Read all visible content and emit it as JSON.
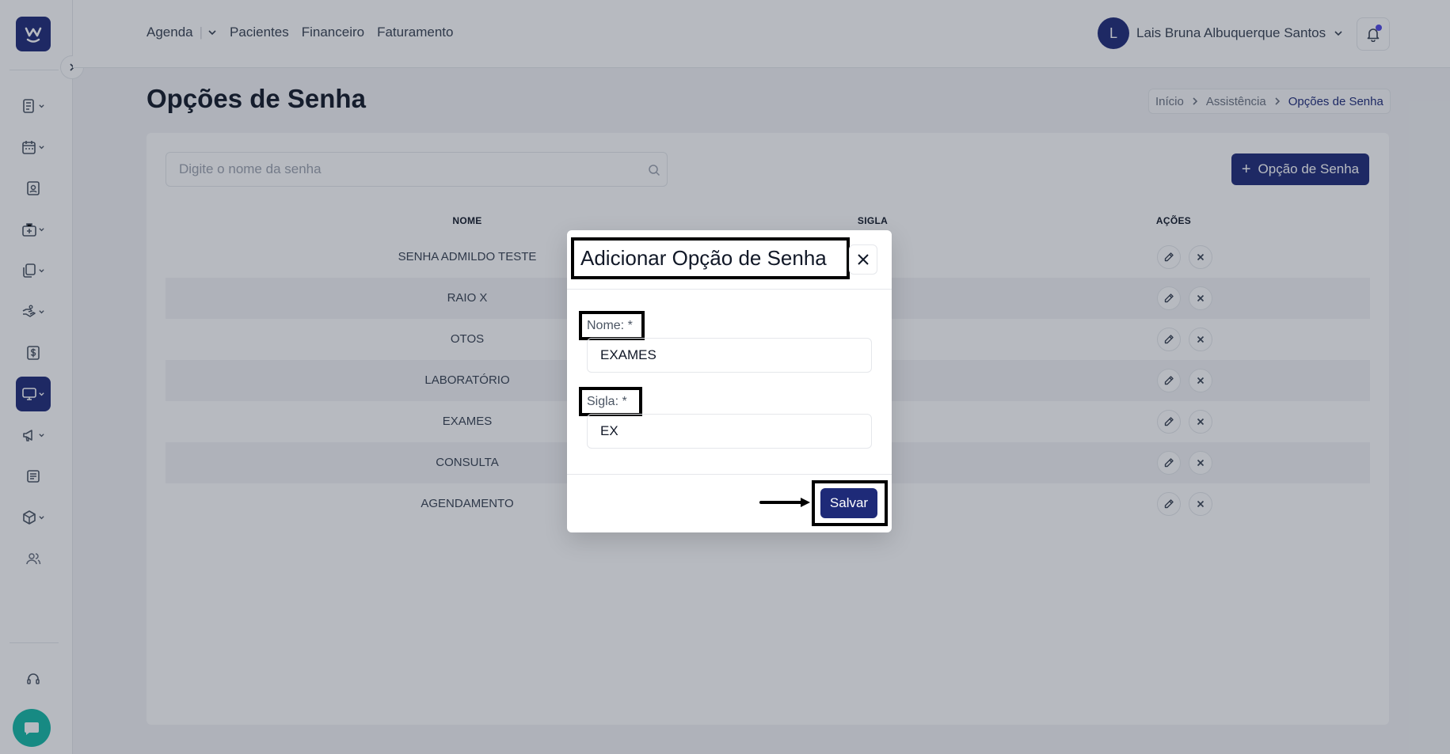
{
  "nav": {
    "items": [
      "Agenda",
      "Pacientes",
      "Financeiro",
      "Faturamento"
    ],
    "agenda_separator": "|"
  },
  "user": {
    "initial": "L",
    "name": "Lais Bruna Albuquerque Santos"
  },
  "page": {
    "title": "Opções de Senha"
  },
  "breadcrumb": [
    "Início",
    "Assistência",
    "Opções de Senha"
  ],
  "search": {
    "placeholder": "Digite o nome da senha"
  },
  "add_button": {
    "label": "Opção de Senha"
  },
  "table": {
    "headers": [
      "NOME",
      "SIGLA",
      "AÇÕES"
    ],
    "rows": [
      "SENHA ADMILDO TESTE",
      "RAIO X",
      "OTOS",
      "LABORATÓRIO",
      "EXAMES",
      "CONSULTA",
      "AGENDAMENTO"
    ]
  },
  "modal": {
    "title": "Adicionar Opção de Senha",
    "name_label": "Nome: *",
    "name_value": "EXAMES",
    "sigla_label": "Sigla: *",
    "sigla_value": "EX",
    "save_label": "Salvar"
  },
  "colors": {
    "brand": "#1e2a78",
    "chat": "#14b8a6",
    "notification_dot": "#4f46e5"
  },
  "icons": {
    "logo": "w-logo-icon",
    "sidebar": [
      "list-icon",
      "calendar-icon",
      "id-card-icon",
      "medical-bag-icon",
      "documents-icon",
      "hand-icon",
      "dollar-icon",
      "monitor-icon",
      "megaphone-icon",
      "newspaper-icon",
      "box-icon",
      "users-icon",
      "headset-icon"
    ],
    "chat": "chat-icon",
    "bell": "bell-icon",
    "row_actions": [
      "pencil-icon",
      "x-icon"
    ]
  }
}
